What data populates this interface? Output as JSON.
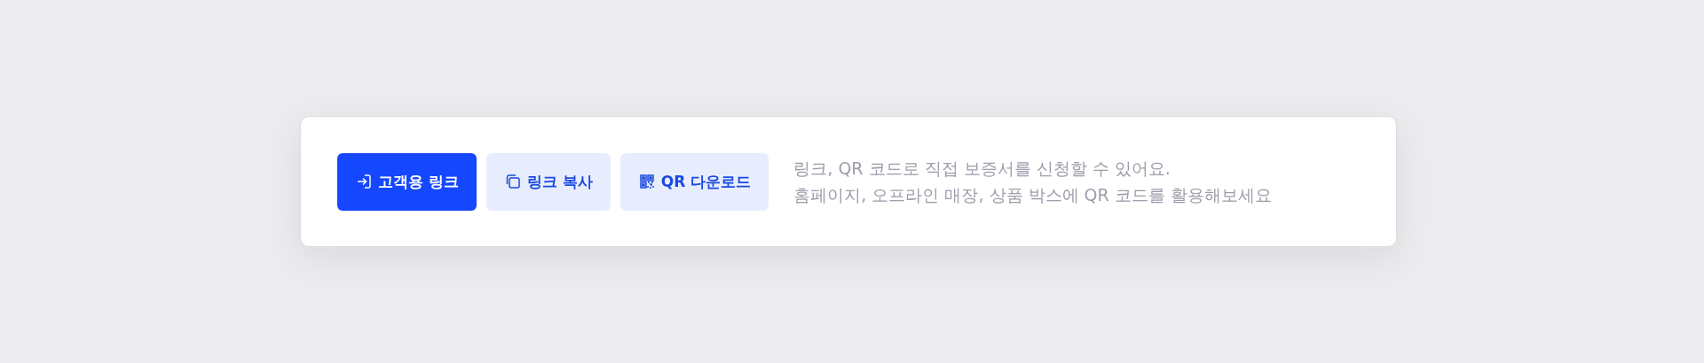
{
  "actions": [
    {
      "label": "고객용 링크",
      "kind": "primary"
    },
    {
      "label": "링크 복사",
      "kind": "secondary"
    },
    {
      "label": "QR 다운로드",
      "kind": "secondary"
    }
  ],
  "description": [
    "링크, QR 코드로 직접 보증서를 신청할 수 있어요.",
    "홈페이지, 오프라인 매장, 상품 박스에 QR 코드를 활용해보세요"
  ]
}
